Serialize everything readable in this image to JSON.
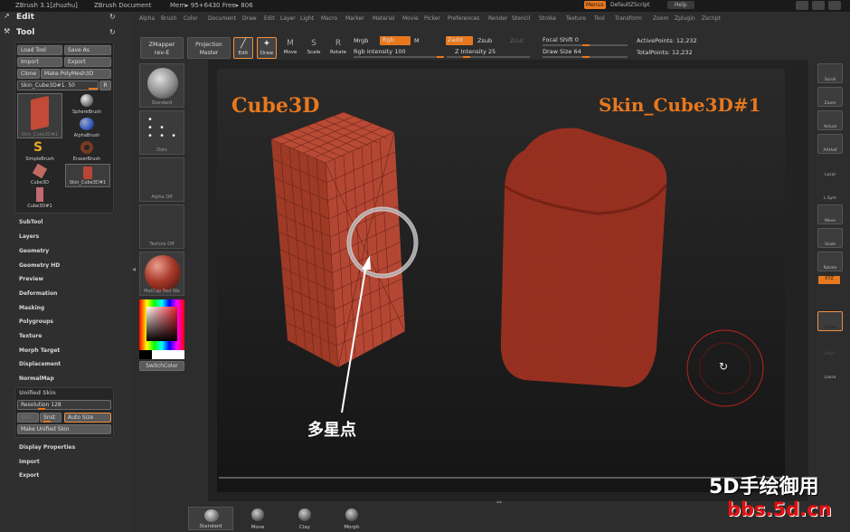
{
  "title_bar": {
    "app": "ZBrush  3.1[zhuzhu]",
    "document": "ZBrush Document",
    "mem": "Mem▸ 95+6430 Free▸ 806",
    "menus_button": "Menus",
    "script_name": "DefaultZScript",
    "help": "Help"
  },
  "menu_bar": [
    "Alpha",
    "Brush",
    "Color",
    "Document",
    "Draw",
    "Edit",
    "Layer",
    "Light",
    "Macro",
    "Marker",
    "Material",
    "Movie",
    "Picker",
    "Preferences",
    "Render",
    "Stencil",
    "Stroke",
    "Texture",
    "Tool",
    "Transform",
    "Zoom",
    "Zplugin",
    "Zscript"
  ],
  "left_panel": {
    "edit_header": "Edit",
    "tool_header": "Tool",
    "load_tool": "Load Tool",
    "save_as": "Save As",
    "import": "Import",
    "export": "Export",
    "clone": "Clone",
    "make_polymesh": "Make PolyMesh3D",
    "current_tool": "Skin_Cube3D#1. 50",
    "r_button": "R",
    "tool_palette": [
      {
        "name": "Skin_Cube3D#1",
        "color": "#c24a37"
      },
      {
        "name": "SphereBrush",
        "color": "#888"
      },
      {
        "name": "AlphaBrush",
        "color": "#3c5cc9"
      },
      {
        "name": "SimpleBrush",
        "color": "#e8a81e"
      },
      {
        "name": "EraserBrush",
        "color": "#7a3a22"
      },
      {
        "name": "Cube3D",
        "color": "#c26a60"
      },
      {
        "name": "Skin_Cube3D#1",
        "color": "#b84636"
      },
      {
        "name": "Cube3D#1",
        "color": "#c26a72"
      }
    ],
    "sub_items": [
      "SubTool",
      "Layers",
      "Geometry",
      "Geometry HD",
      "Preview",
      "Deformation",
      "Masking",
      "Polygroups",
      "Texture",
      "Morph Target",
      "Displacement",
      "NormalMap"
    ],
    "unified_skin": {
      "header": "Unified Skin",
      "resolution": "Resolution 128",
      "smooth": "Smt",
      "snst": "Snst",
      "auto_size": "Auto Size",
      "make": "Make Unified Skin"
    },
    "bottom_items": [
      "Display Properties",
      "Import",
      "Export"
    ]
  },
  "shelf": {
    "zmapper_top": "ZMapper",
    "zmapper_bot": "rev-E",
    "projection_top": "Projection",
    "projection_bot": "Master",
    "edit": "Edit",
    "draw": "Draw",
    "move": "Move",
    "scale": "Scale",
    "rotate": "Rotate",
    "mrgb": "Mrgb",
    "rgb": "Rgb",
    "m": "M",
    "rgb_intensity": "Rgb Intensity 100",
    "zadd": "Zadd",
    "zsub": "Zsub",
    "zcut": "Zcut",
    "z_intensity": "Z Intensity 25",
    "focal_shift": "Focal Shift 0",
    "draw_size": "Draw Size 64",
    "active_points": "ActivePoints: 12,232",
    "total_points": "TotalPoints: 12,232"
  },
  "materials": [
    {
      "name": "Standard"
    },
    {
      "name": "Dots"
    },
    {
      "name": "Alpha Off"
    },
    {
      "name": "Texture Off"
    },
    {
      "name": "MatCap Red Wa"
    }
  ],
  "switch_color": "SwitchColor",
  "right_panel": [
    "Scroll",
    "Zoom",
    "Actual",
    "AAHalf",
    "Local",
    "L.Sym",
    "Move",
    "Scale",
    "Rotate",
    "Frame",
    "PolyF",
    "Lasso"
  ],
  "right_xyz": "XYZ",
  "canvas": {
    "label_left": "Cube3D",
    "label_right": "Skin_Cube3D#1",
    "annotation": "多星点",
    "watermark_top": "5D手绘御用",
    "watermark_bot": "bbs.5d.cn",
    "accent": "#e8781e"
  },
  "bottom_shelf": [
    "Standard",
    "Move",
    "Clay",
    "Morph"
  ]
}
